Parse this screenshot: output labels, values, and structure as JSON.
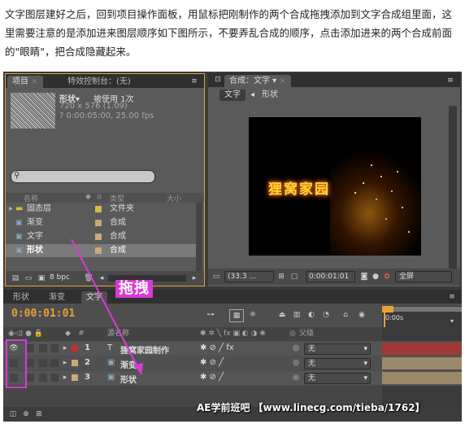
{
  "intro_text": "文字图层建好之后，回到项目操作面板，用鼠标把刚制作的两个合成拖拽添加到文字合成组里面，这里需要注意的是添加进来图层顺序如下图所示，不要弄乱合成的顺序，点击添加进来的两个合成前面的\"眼睛\"，把合成隐藏起来。",
  "project_panel": {
    "tabs": [
      "项目",
      "特效控制台：(无)"
    ],
    "item_name": "形状▾",
    "item_used": "被使用 1次",
    "item_dims": "720 x 576 (1.09)",
    "item_duration": "? 0:00:05:00, 25.00 fps",
    "columns": [
      "名称",
      "类型",
      "大小"
    ],
    "items": [
      {
        "name": "固态层",
        "type": "文件夹",
        "swatch": "#d4b94a"
      },
      {
        "name": "渐变",
        "type": "合成",
        "swatch": "#c8a977"
      },
      {
        "name": "文字",
        "type": "合成",
        "swatch": "#c8a977"
      },
      {
        "name": "形状",
        "type": "合成",
        "swatch": "#c8a977"
      }
    ],
    "bpc": "8 bpc"
  },
  "comp_panel": {
    "tab": "合成：文字",
    "breadcrumbs": [
      "文字",
      "形状"
    ],
    "preview_text": "狸窝家园",
    "zoom": "(33.3 ...",
    "timecode": "0:00:01:01",
    "view": "全屏"
  },
  "timeline": {
    "tabs": [
      "形状",
      "渐变",
      "文字"
    ],
    "timecode": "0:00:01:01",
    "ruler_label": "0:00s",
    "header_label": "源名称",
    "parent_label": "父级",
    "layers": [
      {
        "num": "1",
        "name": "狸窝家园制作",
        "parent": "无",
        "color": "#c03030",
        "type": "T"
      },
      {
        "num": "2",
        "name": "渐变",
        "parent": "无",
        "color": "#c8a977",
        "type": "comp"
      },
      {
        "num": "3",
        "name": "形状",
        "parent": "无",
        "color": "#c8a977",
        "type": "comp"
      }
    ]
  },
  "annotation": {
    "drag_label": "拖拽",
    "watermark": "AE学前班吧 【www.linecg.com/tieba/1762】"
  },
  "colors": {
    "accent_orange": "#e7a13a",
    "annotation_magenta": "#d63bd6"
  }
}
